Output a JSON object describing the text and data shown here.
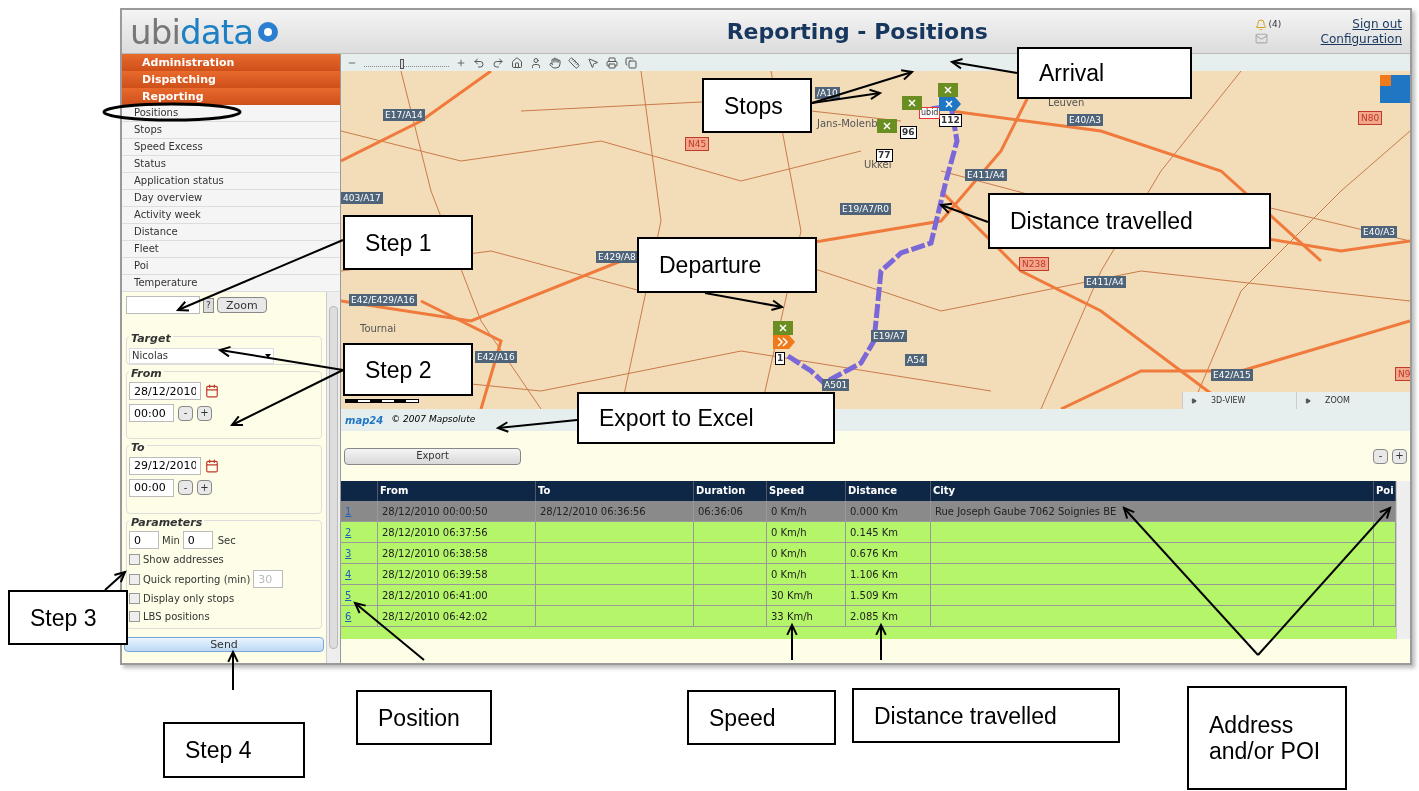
{
  "header": {
    "logo_parts": [
      "ubi",
      "data"
    ],
    "title": "Reporting - Positions",
    "alert_count": "(4)",
    "links": [
      "Sign out",
      "Configuration"
    ]
  },
  "menu": [
    "Administration",
    "Dispatching",
    "Reporting"
  ],
  "submenu": [
    "Positions",
    "Stops",
    "Speed Excess",
    "Status",
    "Application status",
    "Day overview",
    "Activity week",
    "Distance",
    "Fleet",
    "Poi",
    "Temperature"
  ],
  "form": {
    "help_button": "?",
    "zoom_button": "Zoom",
    "target": {
      "legend": "Target",
      "value": "Nicolas"
    },
    "from": {
      "legend": "From",
      "date": "28/12/2010",
      "time": "00:00"
    },
    "to": {
      "legend": "To",
      "date": "29/12/2010",
      "time": "00:00"
    },
    "step_buttons": [
      "-",
      "+"
    ],
    "parameters": {
      "legend": "Parameters",
      "min_value": "0",
      "min_label": "Min",
      "sec_value": "0",
      "sec_label": "Sec",
      "options": [
        {
          "label": "Show addresses",
          "checked": false
        },
        {
          "label": "Quick reporting (min)",
          "checked": false,
          "value": "30"
        },
        {
          "label": "Display only stops",
          "checked": false
        },
        {
          "label": "LBS positions",
          "checked": false
        }
      ]
    },
    "send_button": "Send"
  },
  "map": {
    "zoom_slider": {
      "level": 0.45
    },
    "road_labels": [
      {
        "text": "E17/A14",
        "kind": "motorway"
      },
      {
        "text": "/A10",
        "kind": "motorway"
      },
      {
        "text": "403/A17",
        "kind": "motorway"
      },
      {
        "text": "N45",
        "kind": "national"
      },
      {
        "text": "E19/A7/R0",
        "kind": "motorway"
      },
      {
        "text": "E429/A8",
        "kind": "motorway"
      },
      {
        "text": "E42/E429/A16",
        "kind": "motorway"
      },
      {
        "text": "E42/A16",
        "kind": "motorway"
      },
      {
        "text": "E19/A7",
        "kind": "motorway"
      },
      {
        "text": "A54",
        "kind": "motorway"
      },
      {
        "text": "A501",
        "kind": "motorway"
      },
      {
        "text": "E40/A3",
        "kind": "motorway"
      },
      {
        "text": "E411/A4",
        "kind": "motorway"
      },
      {
        "text": "N80",
        "kind": "national"
      },
      {
        "text": "E40/A3",
        "kind": "motorway"
      },
      {
        "text": "N238",
        "kind": "national"
      },
      {
        "text": "E411/A4",
        "kind": "motorway"
      },
      {
        "text": "E42/A15",
        "kind": "motorway"
      },
      {
        "text": "N9",
        "kind": "national"
      }
    ],
    "places": [
      "Tournai",
      "Ukkel",
      "Leuven",
      "Jans-Molenb"
    ],
    "markers": [
      "1",
      "77",
      "96",
      "112"
    ],
    "poi_label": "ubid",
    "view_buttons": [
      "3D-VIEW",
      "ZOOM"
    ],
    "brand": "map24",
    "copyright": "© 2007 Mapsolute"
  },
  "export_button": "Export",
  "panel_buttons": [
    "-",
    "+"
  ],
  "table": {
    "columns": [
      "From",
      "To",
      "Duration",
      "Speed",
      "Distance",
      "City",
      "Poi"
    ],
    "rows": [
      {
        "index": "1",
        "from": "28/12/2010 00:00:50",
        "to": "28/12/2010 06:36:56",
        "duration": "06:36:06",
        "speed": "0 Km/h",
        "distance": "0.000 Km",
        "city": "Rue Joseph Gaube 7062 Soignies BE",
        "selected": true
      },
      {
        "index": "2",
        "from": "28/12/2010 06:37:56",
        "speed": "0 Km/h",
        "distance": "0.145 Km",
        "selected": false
      },
      {
        "index": "3",
        "from": "28/12/2010 06:38:58",
        "speed": "0 Km/h",
        "distance": "0.676 Km",
        "selected": false
      },
      {
        "index": "4",
        "from": "28/12/2010 06:39:58",
        "speed": "0 Km/h",
        "distance": "1.106 Km",
        "selected": false
      },
      {
        "index": "5",
        "from": "28/12/2010 06:41:00",
        "speed": "30 Km/h",
        "distance": "1.509 Km",
        "selected": false
      },
      {
        "index": "6",
        "from": "28/12/2010 06:42:02",
        "speed": "33 Km/h",
        "distance": "2.085 Km",
        "selected": false
      }
    ]
  },
  "annotations": [
    "Arrival",
    "Stops",
    "Step 1",
    "Departure",
    "Distance travelled",
    "Step 2",
    "Export to Excel",
    "Step 3",
    "Step 4",
    "Position",
    "Speed",
    "Distance travelled",
    "Address and/or POI"
  ]
}
